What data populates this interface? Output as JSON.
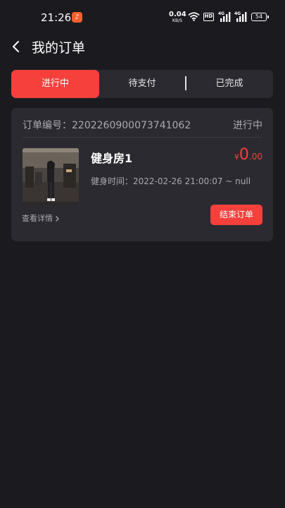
{
  "status_bar": {
    "time": "21:26",
    "net_speed_value": "0.04",
    "net_speed_unit": "KB/S",
    "hd_label": "HD",
    "signal_1_label": "4G",
    "signal_2_label": "4G",
    "battery": "54"
  },
  "header": {
    "title": "我的订单"
  },
  "tabs": [
    {
      "label": "进行中",
      "active": true
    },
    {
      "label": "待支付",
      "active": false
    },
    {
      "label": "已完成",
      "active": false
    }
  ],
  "orders": [
    {
      "order_no_label": "订单编号：",
      "order_no": "2202260900073741062",
      "status": "进行中",
      "gym_name": "健身房1",
      "price_currency": "¥",
      "price_int": "0",
      "price_dec": ".00",
      "time_label": "健身时间：",
      "time_value": "2022-02-26 21:00:07 ~ null",
      "detail_label": "查看详情",
      "end_button_label": "结束订单"
    }
  ],
  "colors": {
    "background": "#1b1b1f",
    "card": "#2a2a30",
    "accent": "#f5403c",
    "muted_text": "#a9a9ae"
  }
}
